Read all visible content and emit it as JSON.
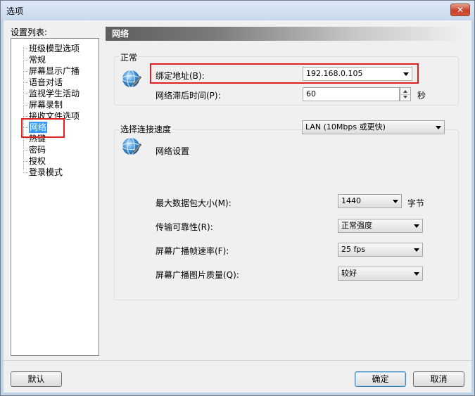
{
  "window": {
    "title": "选项",
    "close_glyph": "✕"
  },
  "sidebar": {
    "title": "设置列表:",
    "items": [
      {
        "label": "班级模型选项"
      },
      {
        "label": "常规"
      },
      {
        "label": "屏幕显示广播"
      },
      {
        "label": "语音对话"
      },
      {
        "label": "监视学生活动"
      },
      {
        "label": "屏幕录制"
      },
      {
        "label": "接收文件选项"
      },
      {
        "label": "网络",
        "selected": true
      },
      {
        "label": "热键"
      },
      {
        "label": "密码"
      },
      {
        "label": "授权"
      },
      {
        "label": "登录模式"
      }
    ]
  },
  "panel": {
    "header": "网络"
  },
  "general": {
    "group_label": "正常",
    "bind_address_label": "绑定地址(B):",
    "bind_address_value": "192.168.0.105",
    "network_timeout_label": "网络滞后时间(P):",
    "network_timeout_value": "60",
    "network_timeout_unit": "秒"
  },
  "speed": {
    "group_label": "选择连接速度",
    "speed_value": "LAN (10Mbps 或更快)",
    "network_settings_label": "网络设置",
    "max_packet_label": "最大数据包大小(M):",
    "max_packet_value": "1440",
    "max_packet_unit": "字节",
    "reliability_label": "传输可靠性(R):",
    "reliability_value": "正常强度",
    "frame_rate_label": "屏幕广播帧速率(F):",
    "frame_rate_value": "25 fps",
    "image_quality_label": "屏幕广播图片质量(Q):",
    "image_quality_value": "较好"
  },
  "footer": {
    "default_label": "默认",
    "ok_label": "确定",
    "cancel_label": "取消"
  },
  "colors": {
    "highlight_box": "#e02020",
    "selection": "#3399ff"
  }
}
